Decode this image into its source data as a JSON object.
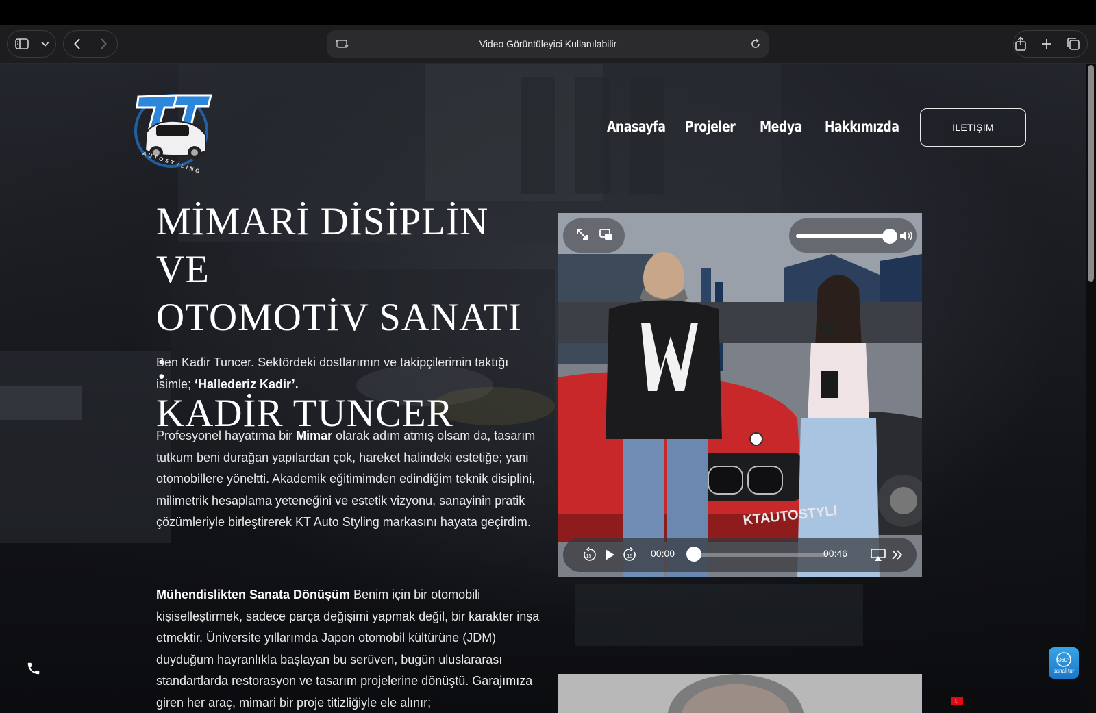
{
  "browser": {
    "address_text": "Video Görüntüleyici Kullanılabilir",
    "icons": [
      "sidebar-icon",
      "chevron-down-icon",
      "back-icon",
      "forward-icon",
      "reader-icon",
      "reload-icon",
      "share-icon",
      "new-tab-icon",
      "tabs-overview-icon"
    ]
  },
  "site": {
    "logo_text": "AUTOSTYLING",
    "nav": [
      "Anasayfa",
      "Projeler",
      "Medya",
      "Hakkımızda"
    ],
    "contact_label": "İLETİŞİM"
  },
  "hero": {
    "title_lines": [
      "MİMARİ DİSİPLİN VE",
      "OTOMOTİV SANATI :",
      "KADİR TUNCER"
    ],
    "p1_pre": "Ben Kadir Tuncer. Sektördeki dostlarımın ve takipçilerimin taktığı isimle; ",
    "p1_bold": "‘Hallederiz Kadir’.",
    "p2_pre": "Profesyonel hayatıma bir ",
    "p2_bold": "Mimar",
    "p2_post": " olarak adım atmış olsam da, tasarım tutkum beni durağan yapılardan çok, hareket halindeki estetiğe; yani otomobillere yöneltti. Akademik eğitimimden edindiğim teknik disiplini, milimetrik hesaplama yeteneğini ve estetik vizyonu, sanayinin pratik çözümleriyle birleştirerek KT Auto Styling markasını hayata geçirdim.",
    "p3_bold": "Mühendislikten Sanata Dönüşüm",
    "p3_post": " Benim için bir otomobili kişiselleştirmek, sadece parça değişimi yapmak değil, bir karakter inşa etmektir. Üniversite yıllarımda Japon otomobil kültürüne (JDM) duyduğum hayranlıkla başlayan bu serüven, bugün uluslararası standartlarda restorasyon ve tasarım projelerine dönüştü. Garajımıza giren her araç, mimari bir proje titizliğiyle ele alınır;"
  },
  "video": {
    "current_time": "00:00",
    "duration": "00:46",
    "volume": 0.95,
    "progress": 0.0,
    "watermark": "KTAUTOSTYLI"
  },
  "floating": {
    "tour_label": "sanal tur",
    "tour_badge": "360°"
  }
}
